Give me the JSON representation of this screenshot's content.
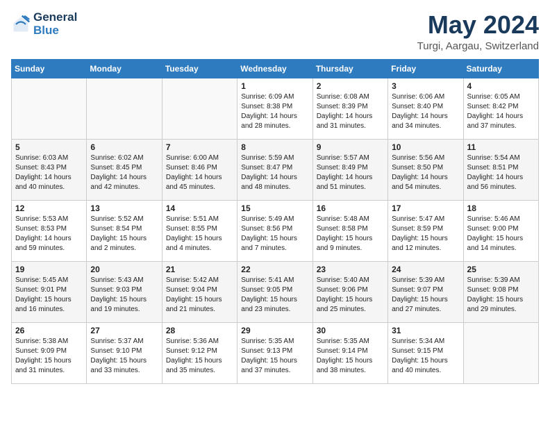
{
  "header": {
    "logo_line1": "General",
    "logo_line2": "Blue",
    "month": "May 2024",
    "location": "Turgi, Aargau, Switzerland"
  },
  "days_of_week": [
    "Sunday",
    "Monday",
    "Tuesday",
    "Wednesday",
    "Thursday",
    "Friday",
    "Saturday"
  ],
  "weeks": [
    [
      {
        "day": "",
        "content": ""
      },
      {
        "day": "",
        "content": ""
      },
      {
        "day": "",
        "content": ""
      },
      {
        "day": "1",
        "content": "Sunrise: 6:09 AM\nSunset: 8:38 PM\nDaylight: 14 hours\nand 28 minutes."
      },
      {
        "day": "2",
        "content": "Sunrise: 6:08 AM\nSunset: 8:39 PM\nDaylight: 14 hours\nand 31 minutes."
      },
      {
        "day": "3",
        "content": "Sunrise: 6:06 AM\nSunset: 8:40 PM\nDaylight: 14 hours\nand 34 minutes."
      },
      {
        "day": "4",
        "content": "Sunrise: 6:05 AM\nSunset: 8:42 PM\nDaylight: 14 hours\nand 37 minutes."
      }
    ],
    [
      {
        "day": "5",
        "content": "Sunrise: 6:03 AM\nSunset: 8:43 PM\nDaylight: 14 hours\nand 40 minutes."
      },
      {
        "day": "6",
        "content": "Sunrise: 6:02 AM\nSunset: 8:45 PM\nDaylight: 14 hours\nand 42 minutes."
      },
      {
        "day": "7",
        "content": "Sunrise: 6:00 AM\nSunset: 8:46 PM\nDaylight: 14 hours\nand 45 minutes."
      },
      {
        "day": "8",
        "content": "Sunrise: 5:59 AM\nSunset: 8:47 PM\nDaylight: 14 hours\nand 48 minutes."
      },
      {
        "day": "9",
        "content": "Sunrise: 5:57 AM\nSunset: 8:49 PM\nDaylight: 14 hours\nand 51 minutes."
      },
      {
        "day": "10",
        "content": "Sunrise: 5:56 AM\nSunset: 8:50 PM\nDaylight: 14 hours\nand 54 minutes."
      },
      {
        "day": "11",
        "content": "Sunrise: 5:54 AM\nSunset: 8:51 PM\nDaylight: 14 hours\nand 56 minutes."
      }
    ],
    [
      {
        "day": "12",
        "content": "Sunrise: 5:53 AM\nSunset: 8:53 PM\nDaylight: 14 hours\nand 59 minutes."
      },
      {
        "day": "13",
        "content": "Sunrise: 5:52 AM\nSunset: 8:54 PM\nDaylight: 15 hours\nand 2 minutes."
      },
      {
        "day": "14",
        "content": "Sunrise: 5:51 AM\nSunset: 8:55 PM\nDaylight: 15 hours\nand 4 minutes."
      },
      {
        "day": "15",
        "content": "Sunrise: 5:49 AM\nSunset: 8:56 PM\nDaylight: 15 hours\nand 7 minutes."
      },
      {
        "day": "16",
        "content": "Sunrise: 5:48 AM\nSunset: 8:58 PM\nDaylight: 15 hours\nand 9 minutes."
      },
      {
        "day": "17",
        "content": "Sunrise: 5:47 AM\nSunset: 8:59 PM\nDaylight: 15 hours\nand 12 minutes."
      },
      {
        "day": "18",
        "content": "Sunrise: 5:46 AM\nSunset: 9:00 PM\nDaylight: 15 hours\nand 14 minutes."
      }
    ],
    [
      {
        "day": "19",
        "content": "Sunrise: 5:45 AM\nSunset: 9:01 PM\nDaylight: 15 hours\nand 16 minutes."
      },
      {
        "day": "20",
        "content": "Sunrise: 5:43 AM\nSunset: 9:03 PM\nDaylight: 15 hours\nand 19 minutes."
      },
      {
        "day": "21",
        "content": "Sunrise: 5:42 AM\nSunset: 9:04 PM\nDaylight: 15 hours\nand 21 minutes."
      },
      {
        "day": "22",
        "content": "Sunrise: 5:41 AM\nSunset: 9:05 PM\nDaylight: 15 hours\nand 23 minutes."
      },
      {
        "day": "23",
        "content": "Sunrise: 5:40 AM\nSunset: 9:06 PM\nDaylight: 15 hours\nand 25 minutes."
      },
      {
        "day": "24",
        "content": "Sunrise: 5:39 AM\nSunset: 9:07 PM\nDaylight: 15 hours\nand 27 minutes."
      },
      {
        "day": "25",
        "content": "Sunrise: 5:39 AM\nSunset: 9:08 PM\nDaylight: 15 hours\nand 29 minutes."
      }
    ],
    [
      {
        "day": "26",
        "content": "Sunrise: 5:38 AM\nSunset: 9:09 PM\nDaylight: 15 hours\nand 31 minutes."
      },
      {
        "day": "27",
        "content": "Sunrise: 5:37 AM\nSunset: 9:10 PM\nDaylight: 15 hours\nand 33 minutes."
      },
      {
        "day": "28",
        "content": "Sunrise: 5:36 AM\nSunset: 9:12 PM\nDaylight: 15 hours\nand 35 minutes."
      },
      {
        "day": "29",
        "content": "Sunrise: 5:35 AM\nSunset: 9:13 PM\nDaylight: 15 hours\nand 37 minutes."
      },
      {
        "day": "30",
        "content": "Sunrise: 5:35 AM\nSunset: 9:14 PM\nDaylight: 15 hours\nand 38 minutes."
      },
      {
        "day": "31",
        "content": "Sunrise: 5:34 AM\nSunset: 9:15 PM\nDaylight: 15 hours\nand 40 minutes."
      },
      {
        "day": "",
        "content": ""
      }
    ]
  ]
}
